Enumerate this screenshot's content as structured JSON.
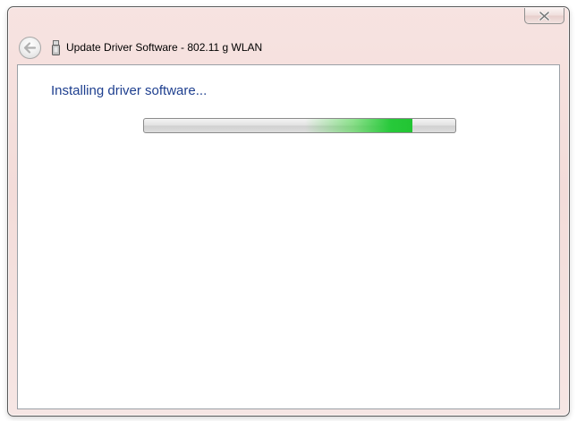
{
  "window": {
    "title": "Update Driver Software - 802.11 g WLAN"
  },
  "icons": {
    "close": "close-icon",
    "back": "back-arrow-icon",
    "device": "usb-device-icon"
  },
  "content": {
    "heading": "Installing driver software..."
  },
  "progress": {
    "mode": "marquee",
    "color": "#27c93a",
    "marquee_position": 0.82
  },
  "colors": {
    "heading": "#1e3f8f",
    "frame": "#f3dcd9"
  }
}
